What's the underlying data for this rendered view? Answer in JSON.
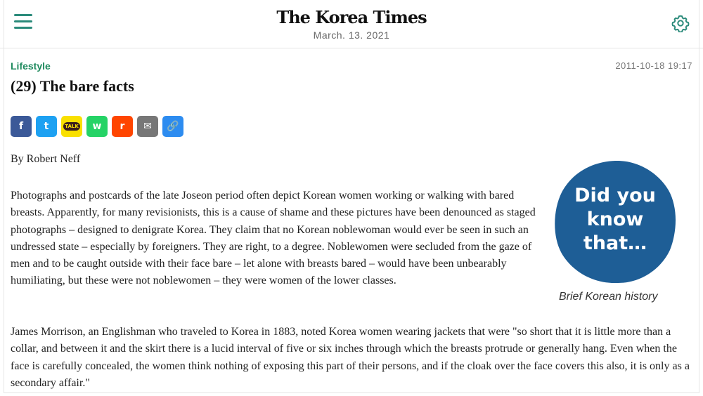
{
  "header": {
    "logo": "The Korea Times",
    "date": "March. 13. 2021"
  },
  "article": {
    "section": "Lifestyle",
    "timestamp": "2011-10-18 19:17",
    "title": "(29) The bare facts",
    "byline": "By Robert Neff",
    "paragraphs": [
      "Photographs and postcards of the late Joseon period often depict Korean women working or walking with bared breasts. Apparently, for many revisionists, this is a cause of shame and these pictures have been denounced as staged photographs – designed to denigrate Korea. They claim that no Korean noblewoman would ever be seen in such an undressed state – especially by foreigners. They are right, to a degree. Noblewomen were secluded from the gaze of men and to be caught outside with their face bare – let alone with breasts bared – would have been unbearably humiliating, but these were not noblewomen – they were women of the lower classes.",
      "James Morrison, an Englishman who traveled to Korea in 1883, noted Korea women wearing jackets that were \"so short that it is little more than a collar, and between it and the skirt there is a lucid interval of five or six inches through which the breasts protrude or generally hang. Even when the face is carefully concealed, the women think nothing of exposing this part of their persons, and if the cloak over the face covers this also, it is only as a secondary affair.\""
    ]
  },
  "share_buttons": [
    {
      "name": "facebook-share-button",
      "icon": "facebook-icon",
      "glyph": "f",
      "color": "#3b5998"
    },
    {
      "name": "twitter-share-button",
      "icon": "twitter-icon",
      "glyph": "t",
      "color": "#1da1f2"
    },
    {
      "name": "kakaotalk-share-button",
      "icon": "kakaotalk-icon",
      "glyph": "TALK",
      "color": "#f9e000"
    },
    {
      "name": "whatsapp-share-button",
      "icon": "whatsapp-icon",
      "glyph": "w",
      "color": "#25d366"
    },
    {
      "name": "reddit-share-button",
      "icon": "reddit-icon",
      "glyph": "r",
      "color": "#ff4500"
    },
    {
      "name": "email-share-button",
      "icon": "email-icon",
      "glyph": "✉",
      "color": "#777777"
    },
    {
      "name": "link-share-button",
      "icon": "link-icon",
      "glyph": "🔗",
      "color": "#2d8cf0"
    }
  ],
  "sidebar_badge": {
    "text_lines": [
      "Did you",
      "know",
      "that…"
    ],
    "caption": "Brief Korean history",
    "color": "#1e5e96"
  },
  "colors": {
    "accent": "#2a8a7a",
    "section": "#1f8a5e"
  }
}
